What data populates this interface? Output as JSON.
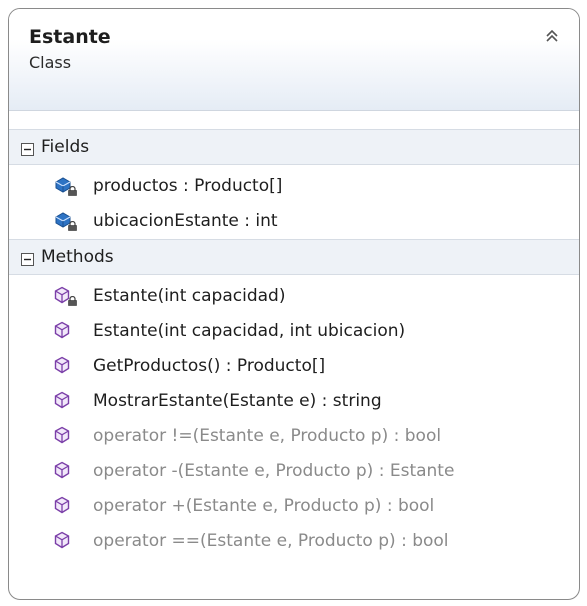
{
  "class": {
    "name": "Estante",
    "kind": "Class"
  },
  "sections": {
    "fields": {
      "title": "Fields",
      "items": [
        {
          "label": "productos : Producto[]",
          "icon": "private-field-icon",
          "dim": false
        },
        {
          "label": "ubicacionEstante : int",
          "icon": "private-field-icon",
          "dim": false
        }
      ]
    },
    "methods": {
      "title": "Methods",
      "items": [
        {
          "label": "Estante(int capacidad)",
          "icon": "private-method-icon",
          "dim": false
        },
        {
          "label": "Estante(int capacidad, int ubicacion)",
          "icon": "method-icon",
          "dim": false
        },
        {
          "label": "GetProductos() : Producto[]",
          "icon": "method-icon",
          "dim": false
        },
        {
          "label": "MostrarEstante(Estante e) : string",
          "icon": "method-icon",
          "dim": false
        },
        {
          "label": "operator !=(Estante e, Producto p) : bool",
          "icon": "method-icon",
          "dim": true
        },
        {
          "label": "operator -(Estante e, Producto p) : Estante",
          "icon": "method-icon",
          "dim": true
        },
        {
          "label": "operator +(Estante e, Producto p) : bool",
          "icon": "method-icon",
          "dim": true
        },
        {
          "label": "operator ==(Estante e, Producto p) : bool",
          "icon": "method-icon",
          "dim": true
        }
      ]
    }
  },
  "colors": {
    "field_icon": "#2d73c4",
    "method_icon": "#7b3fa8",
    "header_gradient_end": "#e5ecf5"
  }
}
